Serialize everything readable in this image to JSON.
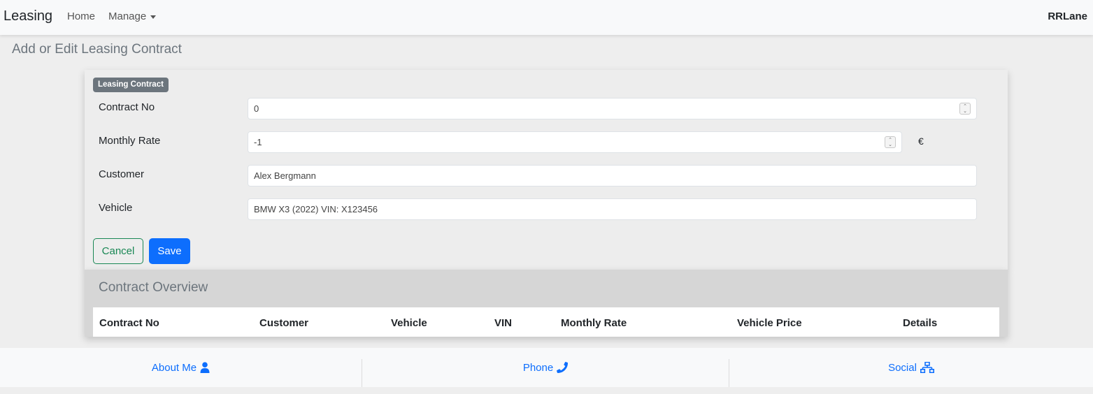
{
  "navbar": {
    "brand": "Leasing",
    "home": "Home",
    "manage": "Manage",
    "user": "RRLane"
  },
  "page_title": "Add or Edit Leasing Contract",
  "form": {
    "badge": "Leasing Contract",
    "contract_no": {
      "label": "Contract No",
      "value": "0"
    },
    "monthly_rate": {
      "label": "Monthly Rate",
      "value": "-1",
      "unit": "€"
    },
    "customer": {
      "label": "Customer",
      "value": "Alex Bergmann"
    },
    "vehicle": {
      "label": "Vehicle",
      "value": "BMW X3 (2022) VIN: X123456"
    },
    "cancel_label": "Cancel",
    "save_label": "Save"
  },
  "overview": {
    "title": "Contract Overview",
    "columns": [
      "Contract No",
      "Customer",
      "Vehicle",
      "VIN",
      "Monthly Rate",
      "Vehicle Price",
      "Details"
    ]
  },
  "footer": {
    "about": "About Me",
    "phone": "Phone",
    "social": "Social"
  },
  "colors": {
    "primary": "#0d6efd",
    "success": "#198754",
    "badge": "#6c757d"
  }
}
